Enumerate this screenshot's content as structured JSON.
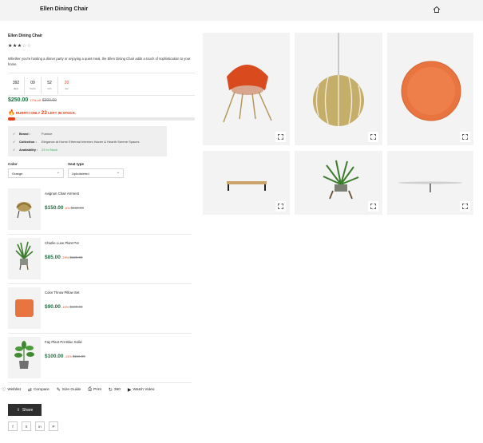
{
  "header": {
    "title": "Ellen Dining Chair"
  },
  "product": {
    "title": "Ellen Dining Chair",
    "rating": 3,
    "rating_max": 5,
    "description": "Whether you're hosting a dinner party or enjoying a quiet meal, the Ellen Dining Chair adds a touch of sophistication to your home.",
    "countdown": [
      {
        "value": "392",
        "label": "days"
      },
      {
        "value": "09",
        "label": "hours"
      },
      {
        "value": "52",
        "label": "min"
      },
      {
        "value": "20",
        "label": "sec"
      }
    ],
    "price": "$250.00",
    "discount": "17% off",
    "old_price": "$300.00",
    "hurry_prefix": "HURRY! ONLY",
    "hurry_count": "23",
    "hurry_suffix": "LEFT IN STOCK.",
    "stock_fraction": 0.04,
    "meta": [
      {
        "key": "Brand :",
        "value": "Furnice",
        "green": false
      },
      {
        "key": "Collection :",
        "value": "Elegance at Home Ethereal Interiors Haven & Hearth Serene Spaces",
        "green": false
      },
      {
        "key": "Availability :",
        "value": "23 In Stock",
        "green": true
      }
    ],
    "color_label": "Color",
    "color_value": "Orange",
    "seat_label": "Seat type",
    "seat_value": "Upholstered"
  },
  "related": [
    {
      "name": "Avignon Chair Armrest",
      "price": "$150.00",
      "off": "-6%",
      "old": "$160.00"
    },
    {
      "name": "Charlie Luxe Plant Pot",
      "price": "$85.00",
      "off": "-29%",
      "old": "$120.00"
    },
    {
      "name": "Color Throw Pillow Set",
      "price": "$90.00",
      "off": "-10%",
      "old": "$100.00"
    },
    {
      "name": "Fay Plant Pot Blue Solid",
      "price": "$100.00",
      "off": "-13%",
      "old": "$115.00"
    }
  ],
  "actions": [
    {
      "label": "Wishlist",
      "icon": "heart-icon",
      "glyph": "♡"
    },
    {
      "label": "Compare",
      "icon": "compare-icon",
      "glyph": "⇄"
    },
    {
      "label": "Size Guide",
      "icon": "ruler-icon",
      "glyph": "✎"
    },
    {
      "label": "Print",
      "icon": "print-icon",
      "glyph": "⎙"
    },
    {
      "label": "360",
      "icon": "rotate-icon",
      "glyph": "↻"
    },
    {
      "label": "Watch Video",
      "icon": "play-icon",
      "glyph": "▶"
    }
  ],
  "share_label": "Share",
  "socials": [
    "f",
    "X",
    "in",
    "P"
  ],
  "colors": {
    "price_green": "#1f6e43",
    "accent_orange": "#e3421b",
    "stock_green": "#2fae57",
    "tile_bg": "#f3f3f3"
  }
}
